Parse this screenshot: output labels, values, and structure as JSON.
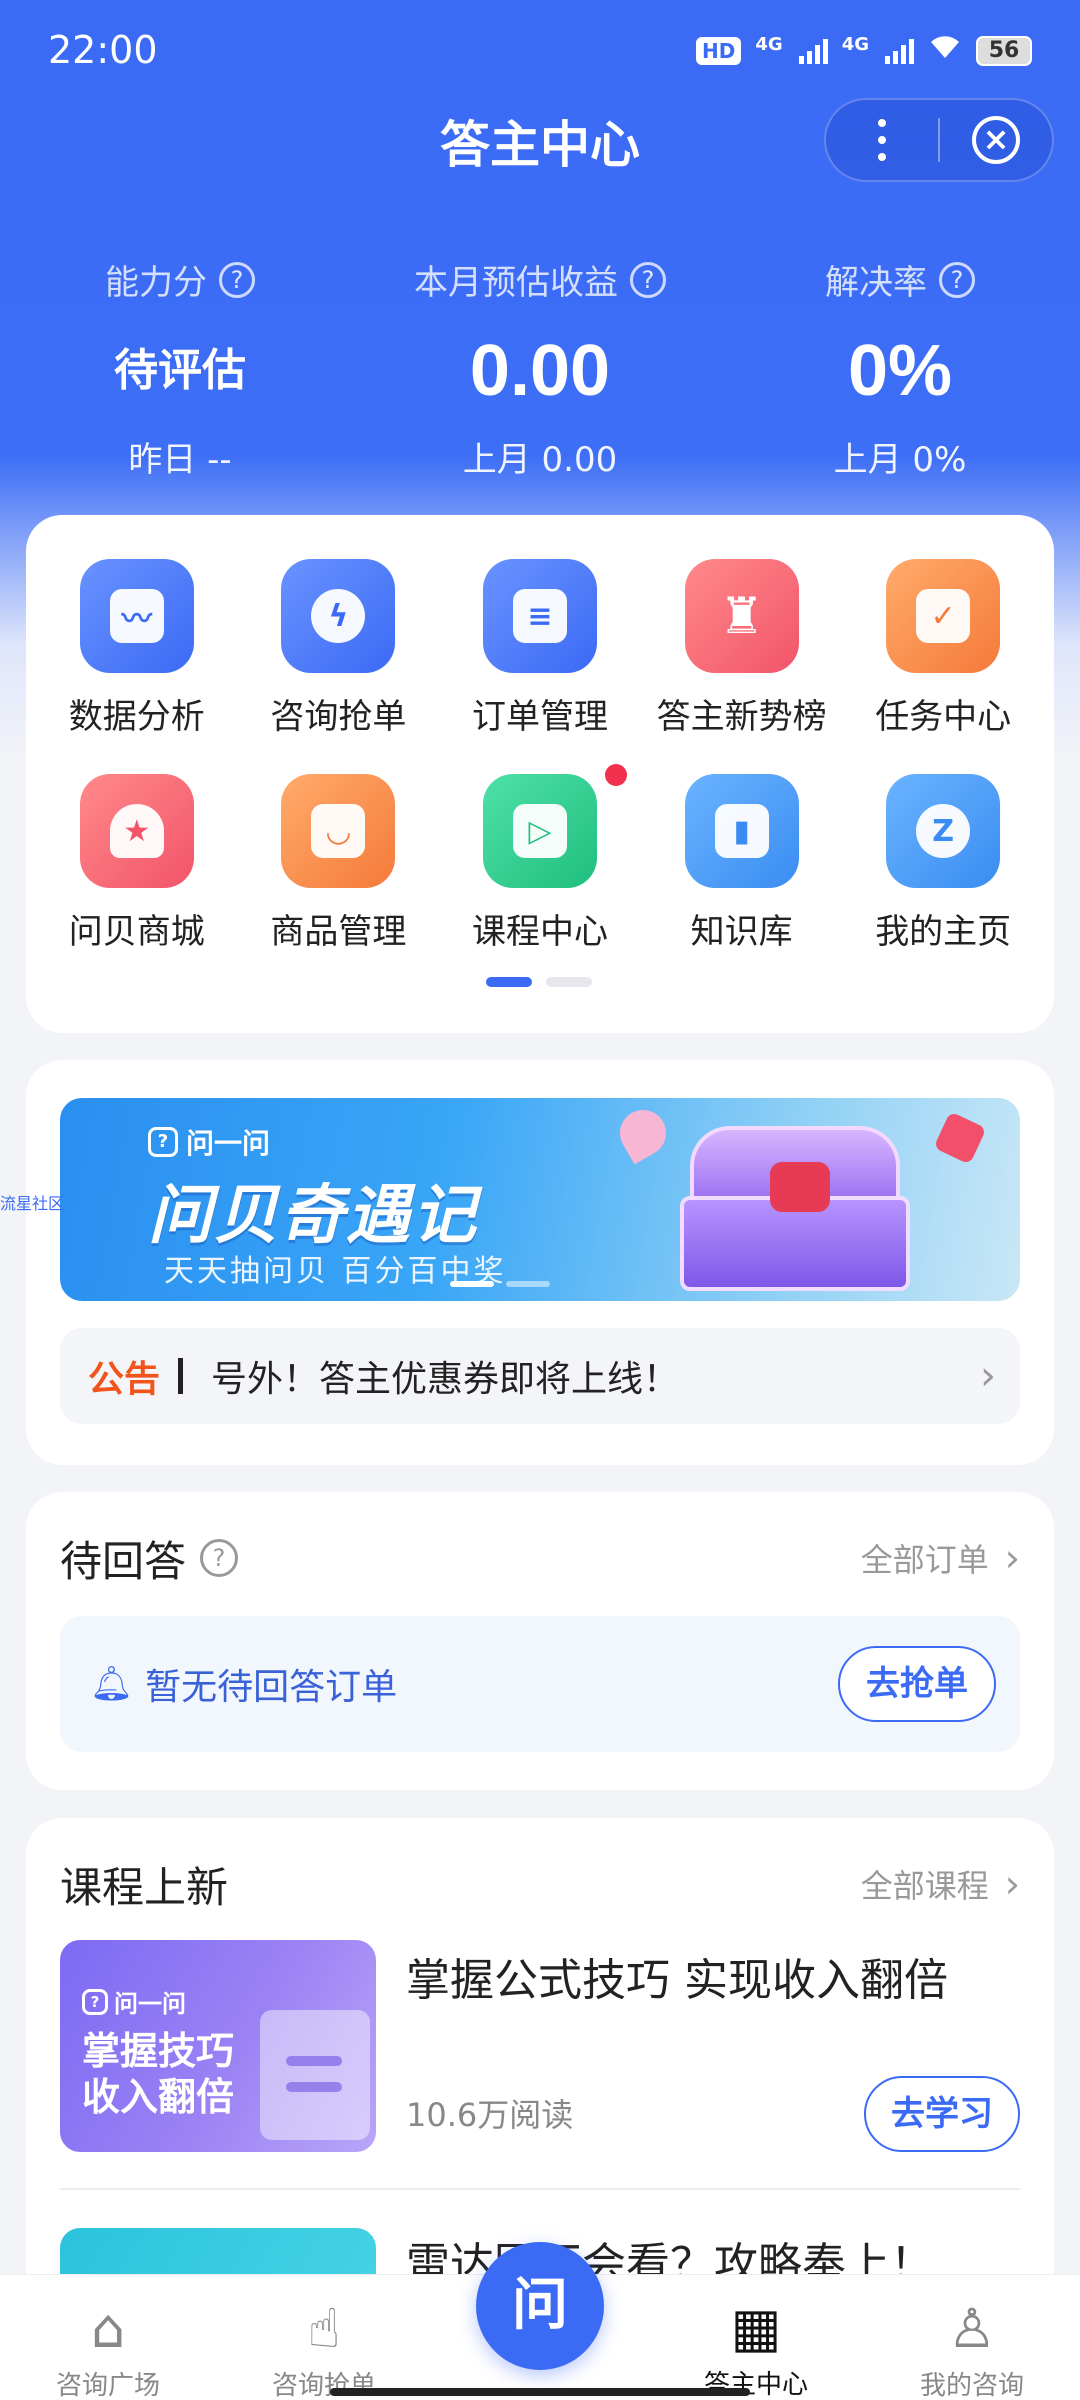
{
  "status_bar": {
    "time": "22:00",
    "hd": "HD",
    "sim1": "4G",
    "sim2": "4G",
    "battery": "56"
  },
  "header": {
    "title": "答主中心"
  },
  "stats": [
    {
      "label": "能力分",
      "value": "待评估",
      "sub": "昨日 --"
    },
    {
      "label": "本月预估收益",
      "value": "0.00",
      "sub": "上月 0.00"
    },
    {
      "label": "解决率",
      "value": "0%",
      "sub": "上月 0%"
    }
  ],
  "menu": {
    "items": [
      {
        "label": "数据分析",
        "icon": "chart-icon",
        "color": "#4f7cf6"
      },
      {
        "label": "咨询抢单",
        "icon": "lightning-icon",
        "color": "#4f7cf6"
      },
      {
        "label": "订单管理",
        "icon": "document-icon",
        "color": "#4f7cf6"
      },
      {
        "label": "答主新势榜",
        "icon": "trophy-icon",
        "color": "#f2606a"
      },
      {
        "label": "任务中心",
        "icon": "task-icon",
        "color": "#f58a4a"
      },
      {
        "label": "问贝商城",
        "icon": "shell-icon",
        "color": "#f2606a"
      },
      {
        "label": "商品管理",
        "icon": "bag-icon",
        "color": "#f58a4a"
      },
      {
        "label": "课程中心",
        "icon": "play-icon",
        "color": "#2fcf8f"
      },
      {
        "label": "知识库",
        "icon": "book-icon",
        "color": "#4a98f5"
      },
      {
        "label": "我的主页",
        "icon": "star-icon",
        "color": "#4a98f5"
      }
    ]
  },
  "banner": {
    "brand": "问一问",
    "title": "问贝奇遇记",
    "subtitle": "天天抽问贝 百分百中奖",
    "side_text": "流星社区"
  },
  "notice": {
    "tag": "公告",
    "text": "号外！答主优惠券即将上线！"
  },
  "pending": {
    "title": "待回答",
    "link": "全部订单",
    "empty_text": "暂无待回答订单",
    "button": "去抢单"
  },
  "courses": {
    "title": "课程上新",
    "link": "全部课程",
    "items": [
      {
        "title": "掌握公式技巧 实现收入翻倍",
        "reads": "10.6万阅读",
        "button": "去学习",
        "thumb_brand": "问一问",
        "thumb_line1": "掌握技巧",
        "thumb_line2": "收入翻倍"
      },
      {
        "title": "雷达图不会看？攻略奉上！"
      }
    ]
  },
  "bottom_nav": {
    "items": [
      {
        "label": "咨询广场"
      },
      {
        "label": "咨询抢单"
      },
      {
        "label": "答主中心",
        "active": true
      },
      {
        "label": "我的咨询"
      }
    ],
    "center": "问"
  }
}
